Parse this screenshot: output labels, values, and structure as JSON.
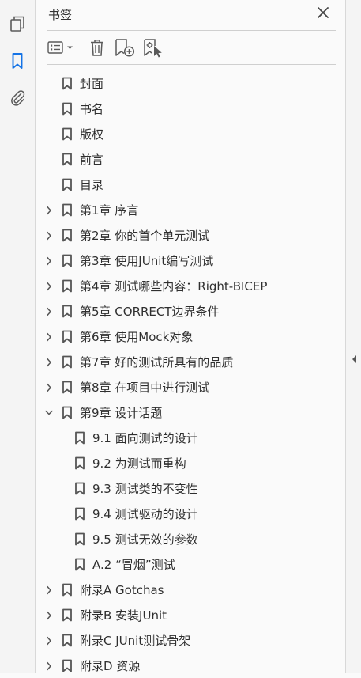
{
  "panel": {
    "title": "书签"
  },
  "bookmarks": [
    {
      "label": "封面",
      "level": 0,
      "expandable": false
    },
    {
      "label": "书名",
      "level": 0,
      "expandable": false
    },
    {
      "label": "版权",
      "level": 0,
      "expandable": false
    },
    {
      "label": "前言",
      "level": 0,
      "expandable": false
    },
    {
      "label": "目录",
      "level": 0,
      "expandable": false
    },
    {
      "label": "第1章  序言",
      "level": 0,
      "expandable": true,
      "expanded": false
    },
    {
      "label": "第2章  你的首个单元测试",
      "level": 0,
      "expandable": true,
      "expanded": false
    },
    {
      "label": "第3章  使用JUnit编写测试",
      "level": 0,
      "expandable": true,
      "expanded": false
    },
    {
      "label": "第4章  测试哪些内容：Right-BICEP",
      "level": 0,
      "expandable": true,
      "expanded": false
    },
    {
      "label": "第5章  CORRECT边界条件",
      "level": 0,
      "expandable": true,
      "expanded": false
    },
    {
      "label": "第6章  使用Mock对象",
      "level": 0,
      "expandable": true,
      "expanded": false
    },
    {
      "label": "第7章  好的测试所具有的品质",
      "level": 0,
      "expandable": true,
      "expanded": false
    },
    {
      "label": "第8章  在项目中进行测试",
      "level": 0,
      "expandable": true,
      "expanded": false
    },
    {
      "label": "第9章  设计话题",
      "level": 0,
      "expandable": true,
      "expanded": true
    },
    {
      "label": "9.1  面向测试的设计",
      "level": 1,
      "expandable": false
    },
    {
      "label": "9.2  为测试而重构",
      "level": 1,
      "expandable": false
    },
    {
      "label": "9.3  测试类的不变性",
      "level": 1,
      "expandable": false
    },
    {
      "label": "9.4  测试驱动的设计",
      "level": 1,
      "expandable": false
    },
    {
      "label": "9.5  测试无效的参数",
      "level": 1,
      "expandable": false
    },
    {
      "label": "A.2  “冒烟”测试",
      "level": 1,
      "expandable": false
    },
    {
      "label": "附录A  Gotchas",
      "level": 0,
      "expandable": true,
      "expanded": false
    },
    {
      "label": "附录B  安装JUnit",
      "level": 0,
      "expandable": true,
      "expanded": false
    },
    {
      "label": "附录C  JUnit测试骨架",
      "level": 0,
      "expandable": true,
      "expanded": false
    },
    {
      "label": "附录D  资源",
      "level": 0,
      "expandable": true,
      "expanded": false
    }
  ],
  "icons": {
    "rail": [
      "pages-icon",
      "bookmark-icon",
      "attachment-icon"
    ],
    "toolbar": [
      "options-menu-icon",
      "delete-icon",
      "new-bookmark-icon",
      "new-bookmark-from-structure-icon"
    ]
  },
  "colors": {
    "accent": "#1473e6",
    "icon": "#5a5a5a"
  }
}
